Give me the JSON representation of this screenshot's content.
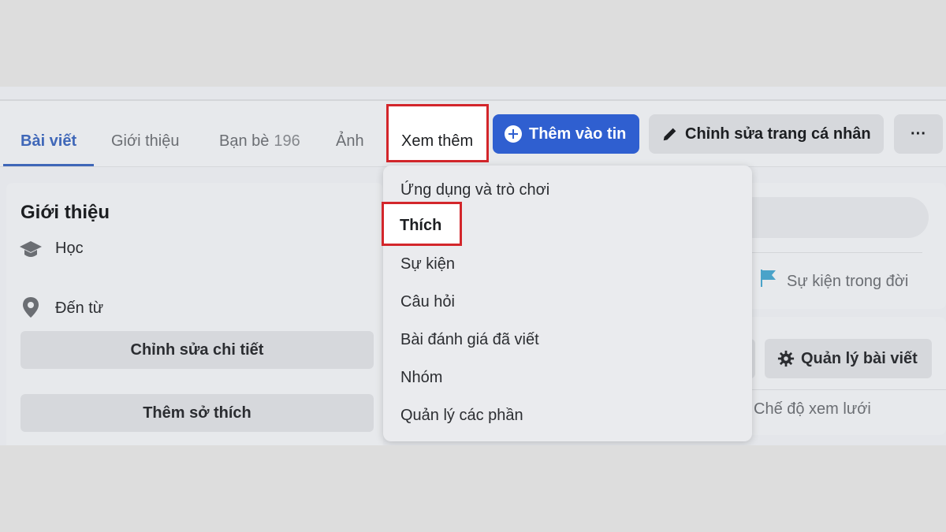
{
  "tabs": {
    "posts": "Bài viết",
    "about": "Giới thiệu",
    "friends": "Bạn bè",
    "friends_count": "196",
    "photos": "Ảnh",
    "more": "Xem thêm"
  },
  "actions": {
    "add_story": "Thêm vào tin",
    "edit_profile": "Chỉnh sửa trang cá nhân",
    "more_options": "···"
  },
  "intro": {
    "title": "Giới thiệu",
    "study": "Học",
    "from": "Đến từ",
    "edit_details": "Chỉnh sửa chi tiết",
    "add_hobbies": "Thêm sở thích"
  },
  "right": {
    "life_event": "Sự kiện trong đời",
    "manage_posts": "Quản lý bài viết",
    "grid_view": "Chế độ xem lưới"
  },
  "menu": {
    "items": [
      "Ứng dụng và trò chơi",
      "Thích",
      "Sự kiện",
      "Câu hỏi",
      "Bài đánh giá đã viết",
      "Nhóm",
      "Quản lý các phần"
    ]
  },
  "colors": {
    "highlight": "#d3262b",
    "primary": "#2f5fd0",
    "active_tab": "#3f67b8"
  }
}
